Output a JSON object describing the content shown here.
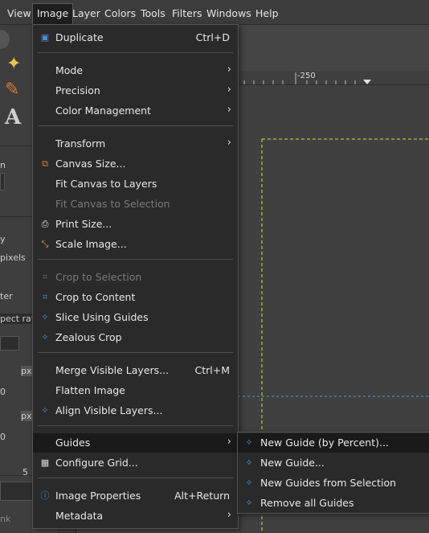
{
  "menubar": {
    "items": [
      "View",
      "Image",
      "Layer",
      "Colors",
      "Tools",
      "Filters",
      "Windows",
      "Help"
    ]
  },
  "ruler": {
    "label": "-250"
  },
  "sidebar": {
    "labels": [
      "n",
      "y",
      "pixels",
      "ter",
      "pect rati",
      "px",
      "0",
      "px",
      "0",
      "5",
      "nk"
    ]
  },
  "image_menu": {
    "items": [
      {
        "label": "Duplicate",
        "shortcut": "Ctrl+D",
        "icon": "duplicate-icon"
      },
      {
        "label": "Mode",
        "submenu": true
      },
      {
        "label": "Precision",
        "submenu": true
      },
      {
        "label": "Color Management",
        "submenu": true
      },
      {
        "label": "Transform",
        "submenu": true
      },
      {
        "label": "Canvas Size...",
        "icon": "canvas-size-icon"
      },
      {
        "label": "Fit Canvas to Layers"
      },
      {
        "label": "Fit Canvas to Selection",
        "disabled": true
      },
      {
        "label": "Print Size...",
        "icon": "printer-icon"
      },
      {
        "label": "Scale Image...",
        "icon": "scale-icon"
      },
      {
        "label": "Crop to Selection",
        "disabled": true,
        "icon": "crop-icon"
      },
      {
        "label": "Crop to Content",
        "icon": "crop-icon"
      },
      {
        "label": "Slice Using Guides",
        "icon": "plugin-icon"
      },
      {
        "label": "Zealous Crop",
        "icon": "plugin-icon"
      },
      {
        "label": "Merge Visible Layers...",
        "shortcut": "Ctrl+M"
      },
      {
        "label": "Flatten Image"
      },
      {
        "label": "Align Visible Layers...",
        "icon": "plugin-icon"
      },
      {
        "label": "Guides",
        "submenu": true,
        "highlighted": true
      },
      {
        "label": "Configure Grid...",
        "icon": "grid-icon"
      },
      {
        "label": "Image Properties",
        "shortcut": "Alt+Return",
        "icon": "info-icon"
      },
      {
        "label": "Metadata",
        "submenu": true
      }
    ]
  },
  "guides_submenu": {
    "items": [
      {
        "label": "New Guide (by Percent)...",
        "highlighted": true,
        "icon": "plugin-icon"
      },
      {
        "label": "New Guide...",
        "icon": "plugin-icon"
      },
      {
        "label": "New Guides from Selection",
        "icon": "plugin-icon"
      },
      {
        "label": "Remove all Guides",
        "icon": "plugin-icon"
      }
    ]
  },
  "colors": {
    "guide": "#4a9adf",
    "selection_dash": "#e0d84a"
  }
}
